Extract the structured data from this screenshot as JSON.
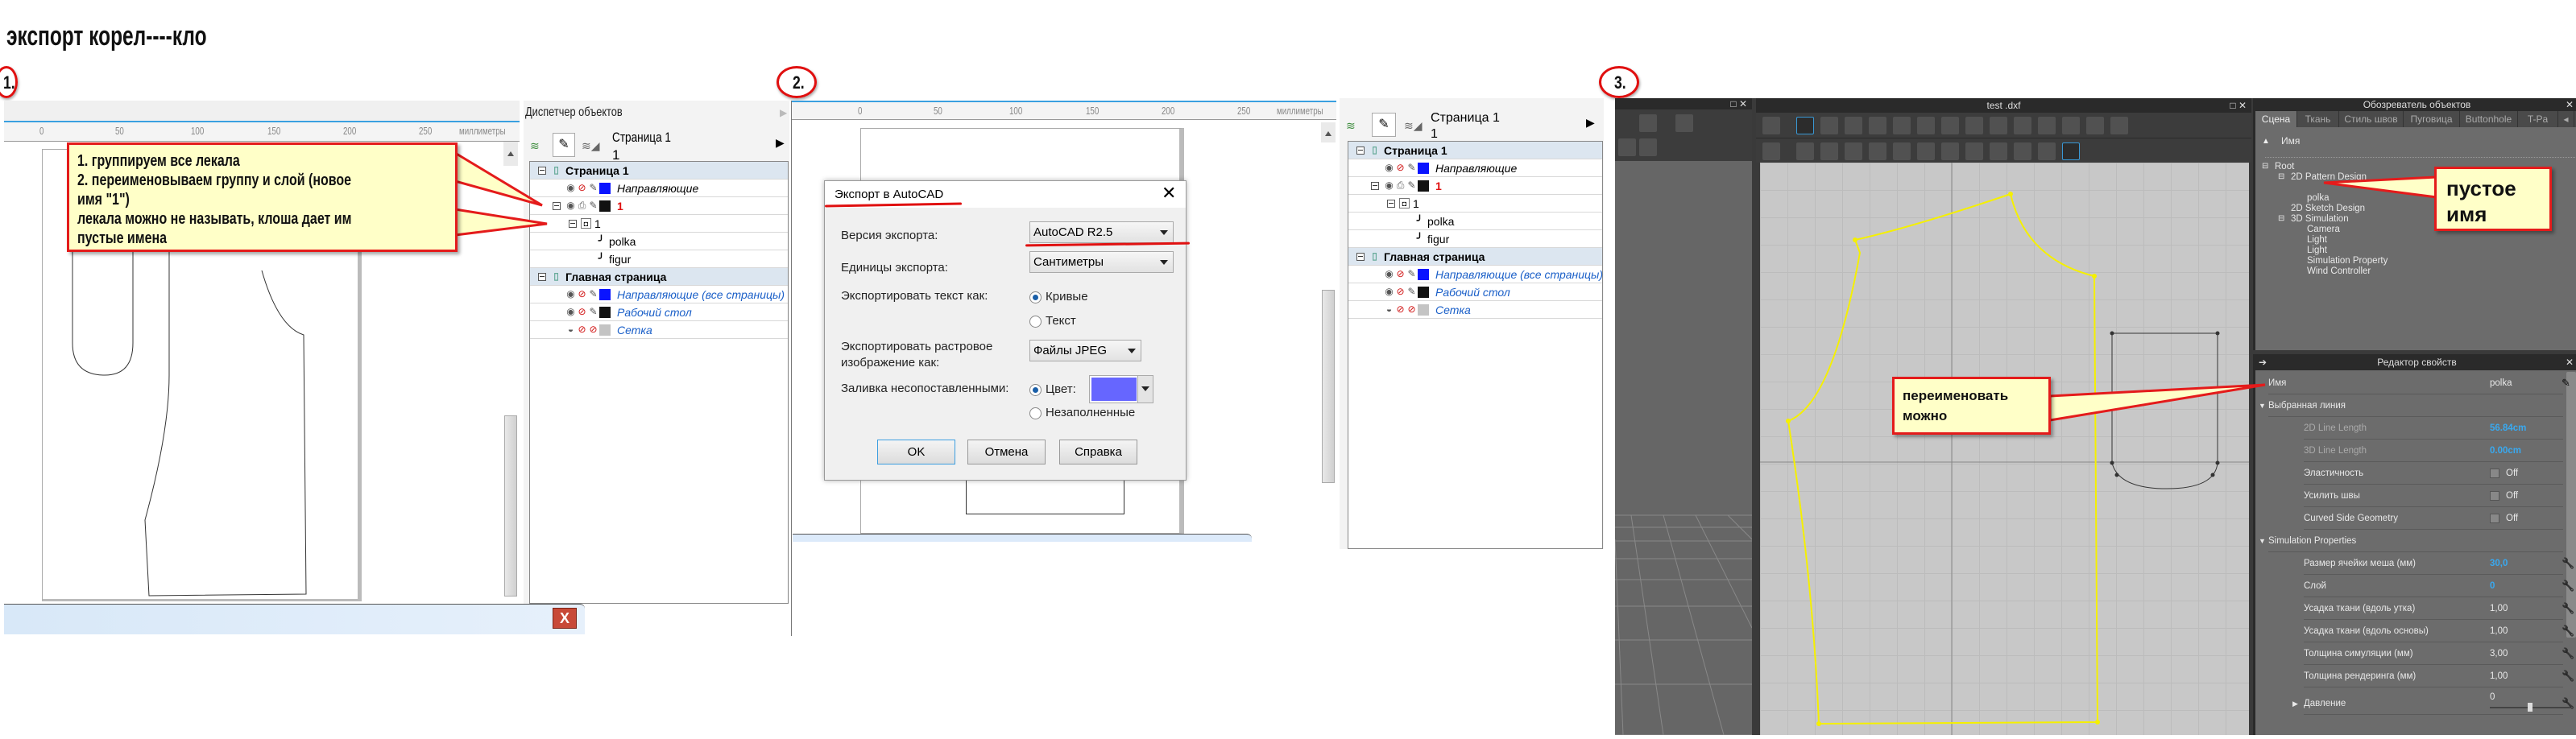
{
  "heading": "экспорт корел----кло",
  "steps": [
    "1.",
    "2.",
    "3."
  ],
  "colors": {
    "callout_bg": "#ffffc8",
    "callout_border": "#e41b1b",
    "clo_accent": "#39a9f0",
    "pattern_yellow": "#f5f000",
    "fill_color": "#6666ff"
  },
  "corel": {
    "docker_title": "Диспетчер объектов",
    "page_label": "Страница 1",
    "layer_label": "1",
    "ruler_ticks": [
      "0",
      "50",
      "100",
      "150",
      "200",
      "250"
    ],
    "ruler_unit": "миллиметры",
    "tree": [
      {
        "label": "Страница 1",
        "kind": "page"
      },
      {
        "label": "Направляющие",
        "kind": "layer",
        "swatch": "#0a14ff",
        "style": "italic"
      },
      {
        "label": "1",
        "kind": "layer-open",
        "swatch": "#111111",
        "style": "red"
      },
      {
        "label": "1",
        "kind": "group"
      },
      {
        "label": "polka",
        "kind": "curve"
      },
      {
        "label": "figur",
        "kind": "curve"
      },
      {
        "label": "Главная страница",
        "kind": "page"
      },
      {
        "label": "Направляющие (все страницы)",
        "kind": "layer",
        "swatch": "#0a14ff",
        "style": "blue"
      },
      {
        "label": "Рабочий стол",
        "kind": "layer",
        "swatch": "#111111",
        "style": "blue"
      },
      {
        "label": "Сетка",
        "kind": "grid",
        "swatch": "#c4c4c4",
        "style": "blue"
      }
    ]
  },
  "callout1": {
    "lines": [
      "1. группируем все лекала",
      "2. переименовываем группу и слой (новое",
      "имя  \"1\")",
      "лекала можно не называть, клоша дает им",
      "пустые имена"
    ]
  },
  "dialog": {
    "title": "Экспорт в AutoCAD",
    "version_label": "Версия экспорта:",
    "version_value": "AutoCAD R2.5",
    "units_label": "Единицы экспорта:",
    "units_value": "Сантиметры",
    "text_as_label": "Экспортировать текст как:",
    "text_as_options": [
      {
        "label": "Кривые",
        "selected": true
      },
      {
        "label": "Текст",
        "selected": false
      }
    ],
    "bitmap_label_1": "Экспортировать растровое",
    "bitmap_label_2": "изображение как:",
    "bitmap_value": "Файлы JPEG",
    "fill_label": "Заливка несопоставленными:",
    "fill_options": [
      {
        "label": "Цвет:",
        "selected": true
      },
      {
        "label": "Незаполненные",
        "selected": false
      }
    ],
    "fill_color": "#6666ff",
    "buttons": {
      "ok": "OK",
      "cancel": "Отмена",
      "help": "Справка"
    }
  },
  "clo": {
    "doc_title": "test .dxf",
    "browser_title": "Обозреватель объектов",
    "tabs": [
      {
        "label": "Сцена",
        "active": true
      },
      {
        "label": "Ткань"
      },
      {
        "label": "Стиль швов"
      },
      {
        "label": "Пуговица"
      },
      {
        "label": "Buttonhole"
      },
      {
        "label": "T-Pa"
      }
    ],
    "name_header": "Имя",
    "scene_tree": [
      {
        "label": "Root",
        "level": 0,
        "expander": true
      },
      {
        "label": "2D Pattern Design",
        "level": 1,
        "expander": true
      },
      {
        "label": "",
        "level": 2
      },
      {
        "label": "polka",
        "level": 2
      },
      {
        "label": "2D Sketch Design",
        "level": 1
      },
      {
        "label": "3D Simulation",
        "level": 1,
        "expander": true
      },
      {
        "label": "Camera",
        "level": 2
      },
      {
        "label": "Light",
        "level": 2
      },
      {
        "label": "Light",
        "level": 2
      },
      {
        "label": "Simulation Property",
        "level": 2
      },
      {
        "label": "Wind Controller",
        "level": 2
      }
    ],
    "callout_empty": [
      "пустое",
      "имя"
    ],
    "callout_rename": [
      "переименовать",
      "можно"
    ],
    "props_title": "Редактор свойств",
    "props": [
      {
        "label": "Имя",
        "value": "polka",
        "type": "name",
        "icon": "pencil-icon"
      },
      {
        "label": "Выбранная линия",
        "type": "section"
      },
      {
        "label": "2D Line Length",
        "value": "56.84cm",
        "type": "readonly"
      },
      {
        "label": "3D Line Length",
        "value": "0.00cm",
        "type": "readonly"
      },
      {
        "label": "Эластичность",
        "value": "Off",
        "type": "check"
      },
      {
        "label": "Усилить швы",
        "value": "Off",
        "type": "check"
      },
      {
        "label": "Curved Side Geometry",
        "value": "Off",
        "type": "check"
      },
      {
        "label": "Simulation Properties",
        "type": "section"
      },
      {
        "label": "Размер ячейки меша (мм)",
        "value": "30,0",
        "type": "accent",
        "icon": "wrench-icon"
      },
      {
        "label": "Слой",
        "value": "0",
        "type": "accent",
        "icon": "wrench-icon"
      },
      {
        "label": "Усадка ткани (вдоль утка)",
        "value": "1,00",
        "type": "plain",
        "icon": "wrench-icon"
      },
      {
        "label": "Усадка ткани (вдоль основы)",
        "value": "1,00",
        "type": "plain",
        "icon": "wrench-icon"
      },
      {
        "label": "Толщина симуляции (мм)",
        "value": "3,00",
        "type": "plain",
        "icon": "wrench-icon"
      },
      {
        "label": "Толщина рендеринга (мм)",
        "value": "1,00",
        "type": "plain",
        "icon": "wrench-icon"
      },
      {
        "label": "Давление",
        "value": "0",
        "type": "slider",
        "icon": "wrench-icon",
        "slider_fraction": 0.5
      }
    ],
    "toolbar_row1": [
      "refresh-icon",
      "transform-pattern-icon",
      "polygon-icon",
      "curve-icon",
      "curved-point-icon",
      "edit-point-icon",
      "rectangle-pattern-icon",
      "square-pattern-icon",
      "circle-pattern-icon",
      "internal-polygon-icon",
      "internal-rectangle-icon",
      "internal-circle-icon",
      "dart-icon",
      "trace-icon",
      "pattern-add-icon"
    ],
    "toolbar_row2": [
      "fold-icon",
      "fold-line-icon",
      "fold-curve-icon",
      "fold-view-icon",
      "garment-icon",
      "segment-sewing-icon",
      "free-sewing-icon",
      "sewing-curve-icon",
      "sewing-view-icon",
      "grain-icon",
      "texture-icon",
      "texture-garment-icon",
      "texture-view-icon"
    ]
  }
}
